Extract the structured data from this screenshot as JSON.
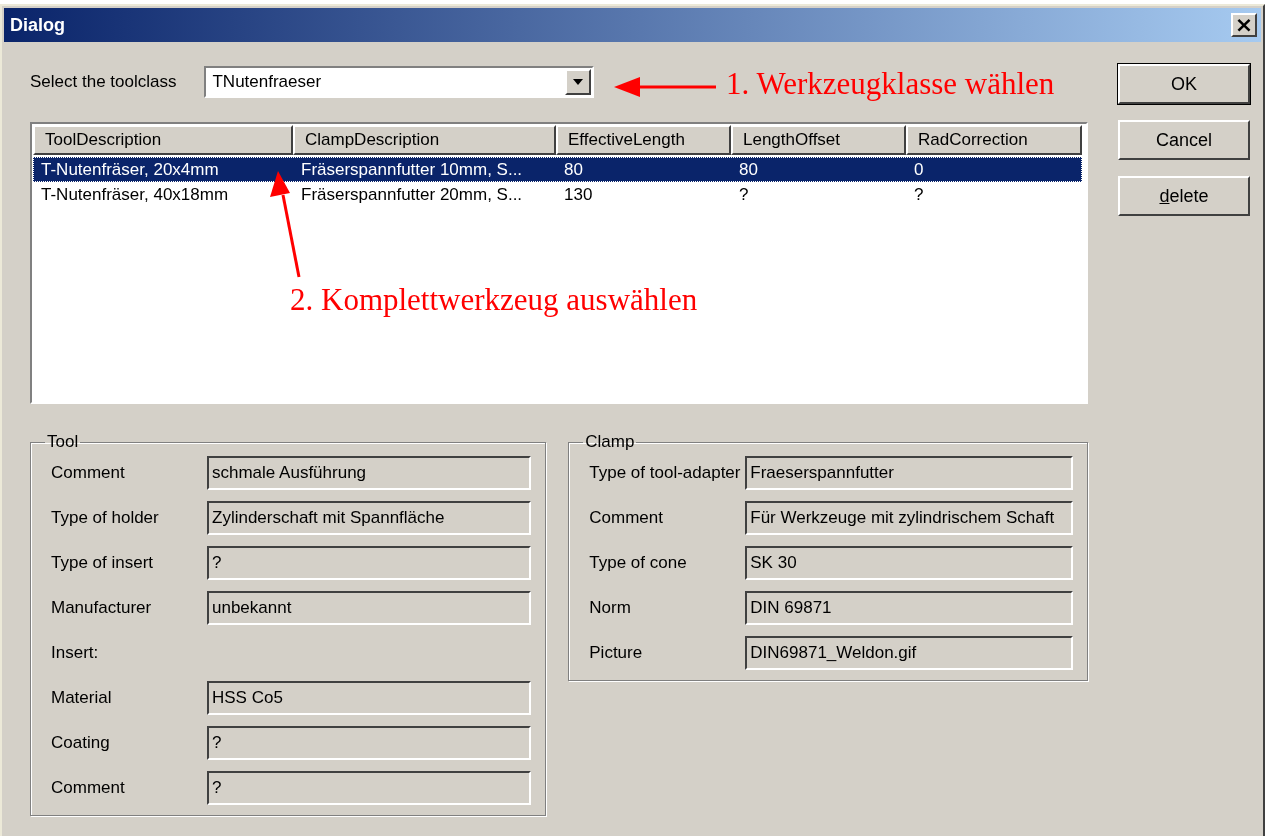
{
  "window": {
    "title": "Dialog",
    "close": "×"
  },
  "toolclass": {
    "label": "Select the toolclass",
    "value": "TNutenfraeser"
  },
  "buttons": [
    {
      "label": "OK",
      "default": true,
      "mnemonic": false
    },
    {
      "label": "Cancel",
      "default": false,
      "mnemonic": false
    },
    {
      "label": "delete",
      "default": false,
      "mnemonic": true
    }
  ],
  "table": {
    "columns": [
      "ToolDescription",
      "ClampDescription",
      "EffectiveLength",
      "LengthOffset",
      "RadCorrection"
    ],
    "rows": [
      {
        "cells": [
          "T-Nutenfräser, 20x4mm",
          "Fräserspannfutter 10mm, S...",
          "80",
          "80",
          "0"
        ],
        "selected": true
      },
      {
        "cells": [
          "T-Nutenfräser, 40x18mm",
          "Fräserspannfutter 20mm, S...",
          "130",
          "?",
          "?"
        ],
        "selected": false
      }
    ]
  },
  "tool": {
    "title": "Tool",
    "rows": [
      {
        "kind": "field",
        "label": "Comment",
        "value": "schmale Ausführung"
      },
      {
        "kind": "field",
        "label": "Type of holder",
        "value": "Zylinderschaft mit Spannfläche"
      },
      {
        "kind": "field",
        "label": "Type of insert",
        "value": "?"
      },
      {
        "kind": "field",
        "label": "Manufacturer",
        "value": "unbekannt"
      },
      {
        "kind": "heading",
        "label": "Insert:"
      },
      {
        "kind": "field",
        "label": "Material",
        "value": "HSS Co5"
      },
      {
        "kind": "field",
        "label": "Coating",
        "value": "?"
      },
      {
        "kind": "field",
        "label": "Comment",
        "value": "?"
      }
    ]
  },
  "clamp": {
    "title": "Clamp",
    "rows": [
      {
        "kind": "field",
        "label": "Type of tool-adapter",
        "value": "Fraeserspannfutter"
      },
      {
        "kind": "field",
        "label": "Comment",
        "value": "Für Werkzeuge mit zylindrischem Schaft"
      },
      {
        "kind": "field",
        "label": "Type of cone",
        "value": "SK 30"
      },
      {
        "kind": "field",
        "label": "Norm",
        "value": "DIN 69871"
      },
      {
        "kind": "field",
        "label": "Picture",
        "value": "DIN69871_Weldon.gif"
      }
    ]
  },
  "annotations": [
    {
      "text": "1. Werkzeugklasse wählen",
      "kind": "horizontal"
    },
    {
      "text": "2. Komplettwerkzeug auswählen",
      "kind": "diagonal"
    }
  ]
}
